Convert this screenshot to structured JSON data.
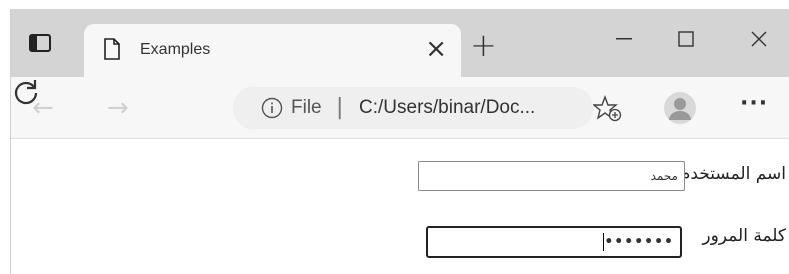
{
  "browser": {
    "tab": {
      "title": "Examples"
    },
    "new_tab_symbol": "+",
    "address": {
      "scheme_label": "File",
      "separator": "|",
      "url": "C:/Users/binar/Doc..."
    }
  },
  "form": {
    "username": {
      "label": "اسم المستخدم",
      "value": "محمد"
    },
    "password": {
      "label": "كلمة المرور",
      "masked_value": "•••••••"
    }
  }
}
